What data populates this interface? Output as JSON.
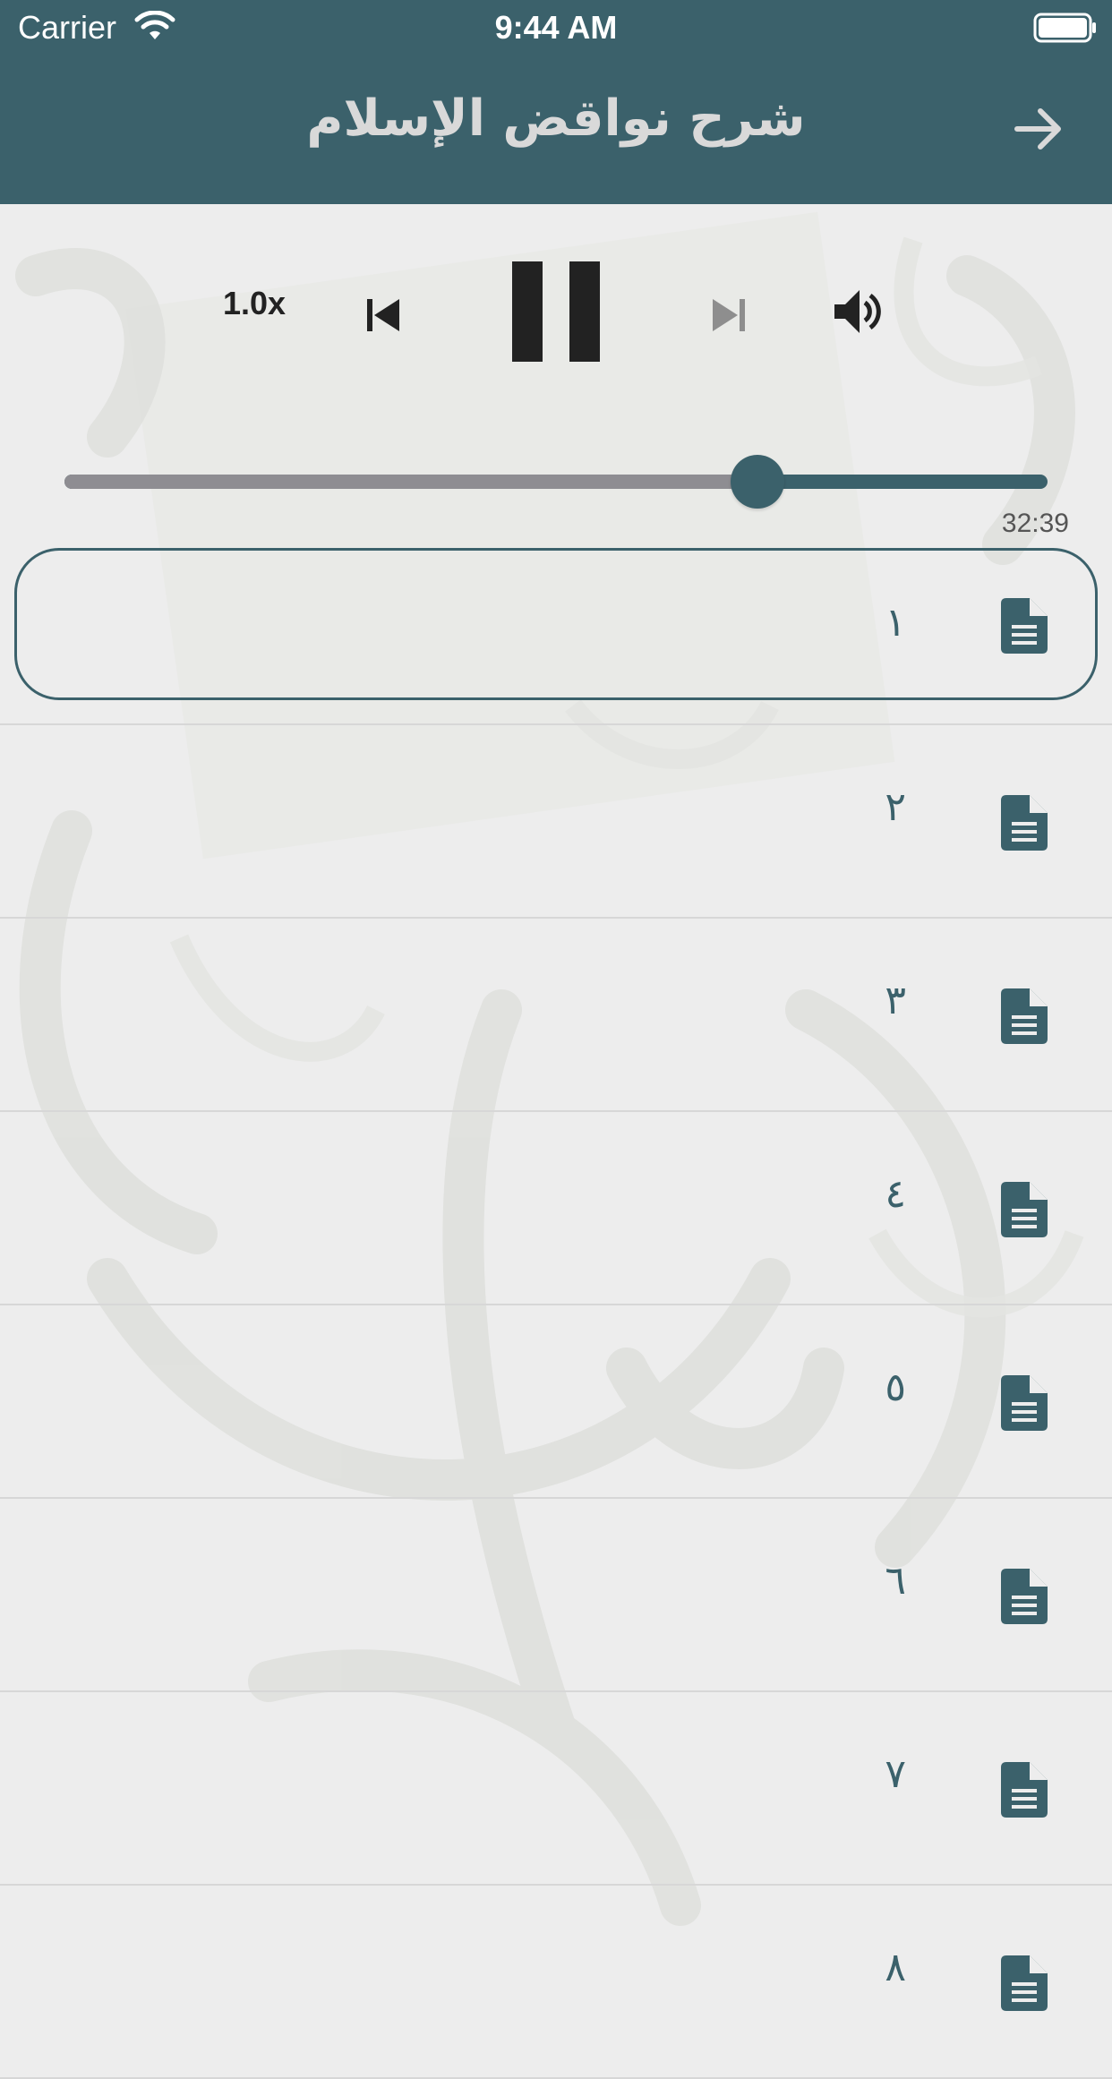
{
  "status_bar": {
    "carrier": "Carrier",
    "time": "9:44 AM"
  },
  "nav": {
    "title": "شرح نواقض الإسلام",
    "back_icon": "arrow-right-icon"
  },
  "player": {
    "speed": "1.0x",
    "state_icon": "pause-icon",
    "progress": 0.705,
    "time": "32:39"
  },
  "tracks": [
    {
      "label": "١",
      "selected": true
    },
    {
      "label": "٢",
      "selected": false
    },
    {
      "label": "٣",
      "selected": false
    },
    {
      "label": "٤",
      "selected": false
    },
    {
      "label": "٥",
      "selected": false
    },
    {
      "label": "٦",
      "selected": false
    },
    {
      "label": "٧",
      "selected": false
    },
    {
      "label": "٨",
      "selected": false
    }
  ],
  "colors": {
    "primary": "#3b616b",
    "background": "#ededed",
    "track_fill": "#8e8d92"
  }
}
